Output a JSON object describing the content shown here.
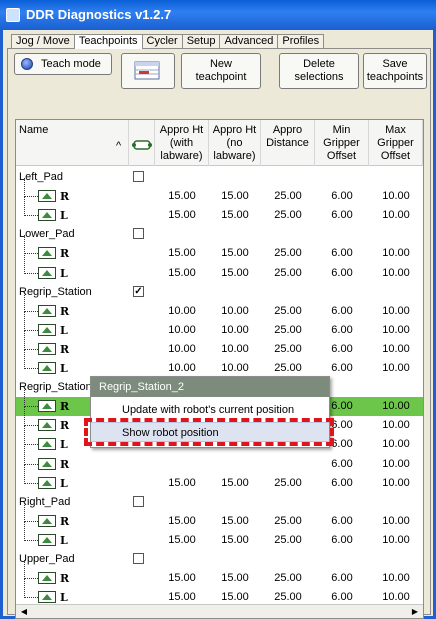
{
  "window": {
    "title": "DDR Diagnostics v1.2.7"
  },
  "tabs": [
    {
      "label": "Jog / Move",
      "active": false
    },
    {
      "label": "Teachpoints",
      "active": true
    },
    {
      "label": "Cycler",
      "active": false
    },
    {
      "label": "Setup",
      "active": false
    },
    {
      "label": "Advanced",
      "active": false
    },
    {
      "label": "Profiles",
      "active": false
    }
  ],
  "toolbar": {
    "teach_mode_label": "Teach mode",
    "new_teachpoint_label": "New\nteachpoint",
    "delete_selections_label": "Delete\nselections",
    "save_teachpoints_label": "Save\nteachpoints"
  },
  "grid": {
    "columns": [
      "Name",
      "",
      "Appro Ht (with labware)",
      "Appro Ht (no labware)",
      "Appro Distance",
      "Min Gripper Offset",
      "Max Gripper Offset"
    ],
    "sort_indicator": "^",
    "rows": [
      {
        "type": "group",
        "name": "Left_Pad",
        "checked": false
      },
      {
        "type": "point",
        "label": "R",
        "values": [
          "15.00",
          "15.00",
          "25.00",
          "6.00",
          "10.00"
        ]
      },
      {
        "type": "point",
        "label": "L",
        "values": [
          "15.00",
          "15.00",
          "25.00",
          "6.00",
          "10.00"
        ]
      },
      {
        "type": "group",
        "name": "Lower_Pad",
        "checked": false
      },
      {
        "type": "point",
        "label": "R",
        "values": [
          "15.00",
          "15.00",
          "25.00",
          "6.00",
          "10.00"
        ]
      },
      {
        "type": "point",
        "label": "L",
        "values": [
          "15.00",
          "15.00",
          "25.00",
          "6.00",
          "10.00"
        ]
      },
      {
        "type": "group",
        "name": "Regrip_Station",
        "checked": true
      },
      {
        "type": "point",
        "label": "R",
        "values": [
          "10.00",
          "10.00",
          "25.00",
          "6.00",
          "10.00"
        ]
      },
      {
        "type": "point",
        "label": "L",
        "values": [
          "10.00",
          "10.00",
          "25.00",
          "6.00",
          "10.00"
        ]
      },
      {
        "type": "point",
        "label": "R",
        "values": [
          "10.00",
          "10.00",
          "25.00",
          "6.00",
          "10.00"
        ]
      },
      {
        "type": "point",
        "label": "L",
        "values": [
          "10.00",
          "10.00",
          "25.00",
          "6.00",
          "10.00"
        ]
      },
      {
        "type": "group",
        "name": "Regrip_Station_2",
        "checked": true
      },
      {
        "type": "point",
        "label": "R",
        "values": [
          "15.00",
          "15.00",
          "25.00",
          "6.00",
          "10.00"
        ],
        "selected": true
      },
      {
        "type": "point",
        "label": "R",
        "values": [
          "",
          "",
          "",
          "6.00",
          "10.00"
        ]
      },
      {
        "type": "point",
        "label": "L",
        "values": [
          "",
          "",
          "",
          "6.00",
          "10.00"
        ]
      },
      {
        "type": "point",
        "label": "R",
        "values": [
          "",
          "",
          "",
          "6.00",
          "10.00"
        ]
      },
      {
        "type": "point",
        "label": "L",
        "values": [
          "15.00",
          "15.00",
          "25.00",
          "6.00",
          "10.00"
        ]
      },
      {
        "type": "group",
        "name": "Right_Pad",
        "checked": false
      },
      {
        "type": "point",
        "label": "R",
        "values": [
          "15.00",
          "15.00",
          "25.00",
          "6.00",
          "10.00"
        ]
      },
      {
        "type": "point",
        "label": "L",
        "values": [
          "15.00",
          "15.00",
          "25.00",
          "6.00",
          "10.00"
        ]
      },
      {
        "type": "group",
        "name": "Upper_Pad",
        "checked": false
      },
      {
        "type": "point",
        "label": "R",
        "values": [
          "15.00",
          "15.00",
          "25.00",
          "6.00",
          "10.00"
        ]
      },
      {
        "type": "point",
        "label": "L",
        "values": [
          "15.00",
          "15.00",
          "25.00",
          "6.00",
          "10.00"
        ]
      }
    ]
  },
  "context_menu": {
    "header": "Regrip_Station_2",
    "items": [
      {
        "label": "Update with robot's current position",
        "highlighted": false
      },
      {
        "label": "Show robot position",
        "highlighted": true
      }
    ]
  },
  "colors": {
    "selected_row": "#6cc64a",
    "annotation_box": "#e0141b",
    "title_bar": "#1f5fd0"
  },
  "icons": {
    "teach_mode": "blue-orb-icon",
    "toolbar_first": "table-teachpoint-icon",
    "checkbox_column": "gripper-icon",
    "teachpoint": "teachpoint-icon",
    "scroll_left": "arrow-left-icon",
    "scroll_right": "arrow-right-icon"
  }
}
